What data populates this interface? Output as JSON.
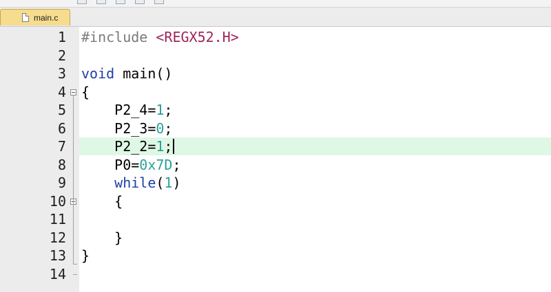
{
  "tab": {
    "label": "main.c",
    "icon": "file-icon"
  },
  "colors": {
    "tab_bg": "#f6dc8f",
    "gutter_bg": "#ececec",
    "current_line_bg": "#dff7e5",
    "keyword": "#1f3da8",
    "number": "#2aa198",
    "preprocessor": "#7a7a7a",
    "include_target": "#a0245a"
  },
  "editor": {
    "current_line": 7,
    "lines": [
      {
        "n": "1",
        "tokens": [
          {
            "t": "#include ",
            "c": "pp"
          },
          {
            "t": "<REGX52.H>",
            "c": "str"
          }
        ]
      },
      {
        "n": "2",
        "tokens": []
      },
      {
        "n": "3",
        "tokens": [
          {
            "t": "void ",
            "c": "kw"
          },
          {
            "t": "main()",
            "c": "op"
          }
        ]
      },
      {
        "n": "4",
        "tokens": [
          {
            "t": "{",
            "c": "op"
          }
        ]
      },
      {
        "n": "5",
        "tokens": [
          {
            "t": "    P2_4=",
            "c": "op"
          },
          {
            "t": "1",
            "c": "num"
          },
          {
            "t": ";",
            "c": "op"
          }
        ]
      },
      {
        "n": "6",
        "tokens": [
          {
            "t": "    P2_3=",
            "c": "op"
          },
          {
            "t": "0",
            "c": "num"
          },
          {
            "t": ";",
            "c": "op"
          }
        ]
      },
      {
        "n": "7",
        "tokens": [
          {
            "t": "    P2_2=",
            "c": "op"
          },
          {
            "t": "1",
            "c": "num"
          },
          {
            "t": ";",
            "c": "op"
          }
        ]
      },
      {
        "n": "8",
        "tokens": [
          {
            "t": "    P0=",
            "c": "op"
          },
          {
            "t": "0x7D",
            "c": "num"
          },
          {
            "t": ";",
            "c": "op"
          }
        ]
      },
      {
        "n": "9",
        "tokens": [
          {
            "t": "    ",
            "c": "op"
          },
          {
            "t": "while",
            "c": "kw"
          },
          {
            "t": "(",
            "c": "op"
          },
          {
            "t": "1",
            "c": "num"
          },
          {
            "t": ")",
            "c": "op"
          }
        ]
      },
      {
        "n": "10",
        "tokens": [
          {
            "t": "    {",
            "c": "op"
          }
        ]
      },
      {
        "n": "11",
        "tokens": []
      },
      {
        "n": "12",
        "tokens": [
          {
            "t": "    }",
            "c": "op"
          }
        ]
      },
      {
        "n": "13",
        "tokens": [
          {
            "t": "}",
            "c": "op"
          }
        ]
      },
      {
        "n": "14",
        "tokens": []
      }
    ],
    "fold_markers": [
      "4",
      "10"
    ]
  }
}
